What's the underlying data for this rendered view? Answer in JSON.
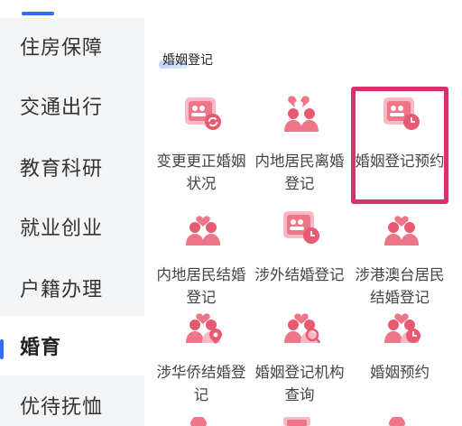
{
  "sidebar": {
    "items": [
      {
        "label": "住房保障"
      },
      {
        "label": "交通出行"
      },
      {
        "label": "教育科研"
      },
      {
        "label": "就业创业"
      },
      {
        "label": "户籍办理"
      },
      {
        "label": "婚育",
        "active": true
      },
      {
        "label": "优待抚恤"
      }
    ]
  },
  "main": {
    "section_title": "婚姻登记",
    "services": [
      {
        "label": "变更更正婚姻状况",
        "icon": "certificate-refresh-icon"
      },
      {
        "label": "内地居民离婚登记",
        "icon": "broken-heart-couple-icon"
      },
      {
        "label": "婚姻登记预约",
        "icon": "certificate-clock-icon"
      },
      {
        "label": "内地居民结婚登记",
        "icon": "heart-couple-icon"
      },
      {
        "label": "涉外结婚登记",
        "icon": "certificate-clock-icon"
      },
      {
        "label": "涉港澳台居民结婚登记",
        "icon": "heart-couple-icon"
      },
      {
        "label": "涉华侨结婚登记",
        "icon": "heart-couple-location-icon"
      },
      {
        "label": "婚姻登记机构查询",
        "icon": "heart-couple-search-icon"
      },
      {
        "label": "婚姻预约",
        "icon": "heart-couple-clock-icon"
      }
    ]
  },
  "colors": {
    "accent": "#2f6bff",
    "icon_pink": "#e85a72",
    "icon_light": "#f7b9c4",
    "highlight": "#d4336e",
    "sidebar_bg": "#f4f5f7"
  }
}
